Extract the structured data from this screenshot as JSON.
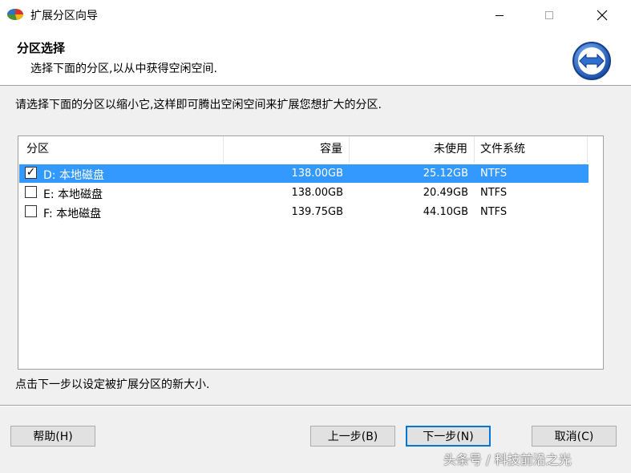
{
  "window": {
    "title": "扩展分区向导",
    "app_icon": "colored-disk-icon",
    "controls": [
      "minimize-icon",
      "maximize-icon",
      "close-icon"
    ]
  },
  "header": {
    "title": "分区选择",
    "subtitle": "选择下面的分区,以从中获得空闲空间.",
    "icon": "double-arrow-icon"
  },
  "instruction": "请选择下面的分区以缩小它,这样即可腾出空闲空间来扩展您想扩大的分区.",
  "table": {
    "columns": {
      "partition": "分区",
      "capacity": "容量",
      "used": "未使用",
      "filesystem": "文件系统"
    },
    "rows": [
      {
        "name": "D: 本地磁盘",
        "capacity": "138.00GB",
        "unused": "25.12GB",
        "fs": "NTFS",
        "checked": true,
        "selected": true
      },
      {
        "name": "E: 本地磁盘",
        "capacity": "138.00GB",
        "unused": "20.49GB",
        "fs": "NTFS",
        "checked": false,
        "selected": false
      },
      {
        "name": "F: 本地磁盘",
        "capacity": "139.75GB",
        "unused": "44.10GB",
        "fs": "NTFS",
        "checked": false,
        "selected": false
      }
    ]
  },
  "hint": "点击下一步以设定被扩展分区的新大小.",
  "buttons": {
    "help": "帮助(H)",
    "prev": "上一步(B)",
    "next": "下一步(N)",
    "cancel": "取消(C)"
  },
  "watermark": "头条号 / 科技前沿之光",
  "colors": {
    "selection": "#3399ff",
    "dialog_bg": "#f0f0f0",
    "default_button_border": "#0078d7"
  }
}
